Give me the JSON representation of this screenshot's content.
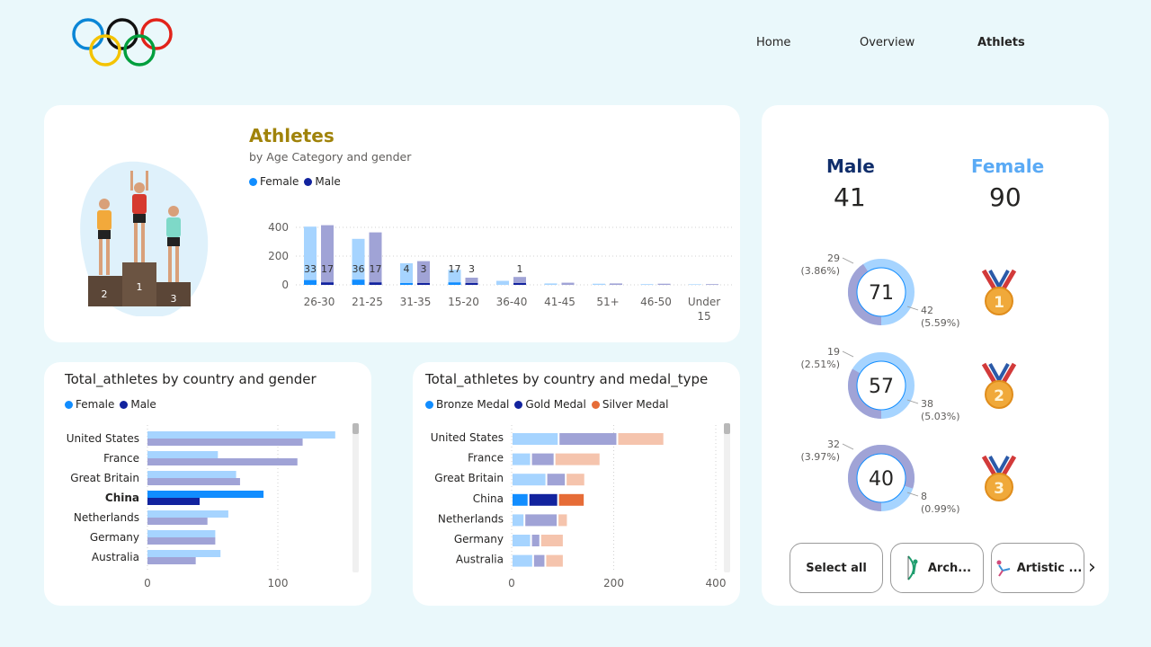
{
  "nav": {
    "home": "Home",
    "overview": "Overview",
    "athlets": "Athlets"
  },
  "colors": {
    "female": "#118dff",
    "male": "#12239e",
    "female_light": "#a6d4ff",
    "male_light": "#a0a3d6",
    "bronze": "#e66c37",
    "gold_title": "#a0830a",
    "male_stat": "#102e6b",
    "female_stat": "#5aaaf5"
  },
  "athletes_card": {
    "title": "Athletes",
    "subtitle": "by Age Category and gender",
    "legend": [
      "Female",
      "Male"
    ]
  },
  "podium": {
    "places": [
      "2",
      "1",
      "3"
    ]
  },
  "country_gender_card": {
    "title": "Total_athletes by country and gender",
    "legend": [
      "Female",
      "Male"
    ]
  },
  "country_medal_card": {
    "title": "Total_athletes by country and medal_type",
    "legend": [
      "Bronze Medal",
      "Gold Medal",
      "Silver Medal"
    ]
  },
  "stats": {
    "male_label": "Male",
    "male_value": "41",
    "female_label": "Female",
    "female_value": "90"
  },
  "donuts": [
    {
      "center": "71",
      "left_value": "29",
      "left_pct": "(3.86%)",
      "right_value": "42",
      "right_pct": "(5.59%)",
      "male_share": 0.408,
      "medal": "1",
      "medal_icon": "gold-medal-icon"
    },
    {
      "center": "57",
      "left_value": "19",
      "left_pct": "(2.51%)",
      "right_value": "38",
      "right_pct": "(5.03%)",
      "male_share": 0.333,
      "medal": "2",
      "medal_icon": "silver-medal-icon"
    },
    {
      "center": "40",
      "left_value": "32",
      "left_pct": "(3.97%)",
      "right_value": "8",
      "right_pct": "(0.99%)",
      "male_share": 0.8,
      "medal": "3",
      "medal_icon": "bronze-medal-icon"
    }
  ],
  "slicer": {
    "select_all": "Select all",
    "archery": "Arch...",
    "artistic": "Artistic ...",
    "next": "›"
  },
  "chart_data": [
    {
      "type": "bar",
      "title": "Athletes",
      "subtitle": "by Age Category and gender",
      "categories": [
        "26-30",
        "21-25",
        "31-35",
        "15-20",
        "36-40",
        "41-45",
        "51+",
        "46-50",
        "Under 15"
      ],
      "category_lines": [
        [
          "26-30"
        ],
        [
          "21-25"
        ],
        [
          "31-35"
        ],
        [
          "15-20"
        ],
        [
          "36-40"
        ],
        [
          "41-45"
        ],
        [
          "51+"
        ],
        [
          "46-50"
        ],
        [
          "Under",
          "15"
        ]
      ],
      "series": [
        {
          "name": "Female",
          "values": [
            405,
            320,
            150,
            105,
            28,
            10,
            8,
            5,
            4
          ],
          "highlighted": [
            33,
            36,
            4,
            17,
            0,
            0,
            0,
            0,
            0
          ],
          "labels": [
            "33",
            "36",
            "4",
            "17",
            "",
            "",
            "",
            "",
            ""
          ]
        },
        {
          "name": "Male",
          "values": [
            415,
            365,
            165,
            50,
            55,
            15,
            10,
            8,
            5
          ],
          "highlighted": [
            17,
            17,
            3,
            3,
            1,
            0,
            0,
            0,
            0
          ],
          "labels": [
            "17",
            "17",
            "3",
            "3",
            "1",
            "",
            "",
            "",
            ""
          ]
        }
      ],
      "ylim": [
        0,
        480
      ],
      "yticks": [
        0,
        200,
        400
      ],
      "legend_position": "top-left",
      "grid": true
    },
    {
      "type": "bar",
      "orientation": "horizontal",
      "title": "Total_athletes by country and gender",
      "categories": [
        "United States",
        "France",
        "Great Britain",
        "China",
        "Netherlands",
        "Germany",
        "Australia"
      ],
      "highlighted_category": "China",
      "series": [
        {
          "name": "Female",
          "values": [
            144,
            54,
            68,
            89,
            62,
            52,
            56
          ]
        },
        {
          "name": "Male",
          "values": [
            119,
            115,
            71,
            40,
            46,
            52,
            37
          ]
        }
      ],
      "xlim": [
        0,
        160
      ],
      "xticks": [
        0,
        100
      ],
      "legend_position": "top-left"
    },
    {
      "type": "bar",
      "orientation": "horizontal",
      "stacked": true,
      "title": "Total_athletes by country and medal_type",
      "categories": [
        "United States",
        "France",
        "Great Britain",
        "China",
        "Netherlands",
        "Germany",
        "Australia"
      ],
      "highlighted_category": "China",
      "series": [
        {
          "name": "Bronze Medal",
          "values": [
            92,
            38,
            68,
            33,
            25,
            38,
            42
          ]
        },
        {
          "name": "Gold Medal",
          "values": [
            115,
            46,
            38,
            58,
            65,
            18,
            24
          ]
        },
        {
          "name": "Silver Medal",
          "values": [
            92,
            90,
            38,
            52,
            20,
            46,
            36
          ]
        }
      ],
      "xlim": [
        0,
        410
      ],
      "xticks": [
        0,
        200,
        400
      ],
      "legend_position": "top-left"
    }
  ]
}
